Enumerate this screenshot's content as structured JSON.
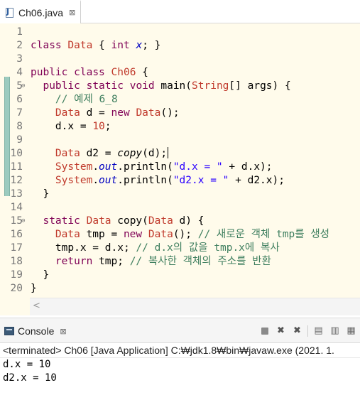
{
  "editor": {
    "tab_label": "Ch06.java",
    "lines": [
      {
        "n": "1"
      },
      {
        "n": "2"
      },
      {
        "n": "3"
      },
      {
        "n": "4"
      },
      {
        "n": "5",
        "fold": "⊖"
      },
      {
        "n": "6"
      },
      {
        "n": "7"
      },
      {
        "n": "8"
      },
      {
        "n": "9"
      },
      {
        "n": "10"
      },
      {
        "n": "11"
      },
      {
        "n": "12"
      },
      {
        "n": "13"
      },
      {
        "n": "14"
      },
      {
        "n": "15",
        "fold": "⊖"
      },
      {
        "n": "16"
      },
      {
        "n": "17"
      },
      {
        "n": "18"
      },
      {
        "n": "19"
      },
      {
        "n": "20"
      }
    ],
    "code": {
      "l2": [
        [
          "kw",
          "class"
        ],
        [
          "",
          " "
        ],
        [
          "cls",
          "Data"
        ],
        [
          "",
          " { "
        ],
        [
          "kw",
          "int"
        ],
        [
          "",
          " "
        ],
        [
          "fld",
          "x"
        ],
        [
          "",
          "; }"
        ]
      ],
      "l4": [
        [
          "kw",
          "public"
        ],
        [
          "",
          " "
        ],
        [
          "kw",
          "class"
        ],
        [
          "",
          " "
        ],
        [
          "cls",
          "Ch06"
        ],
        [
          "",
          " {"
        ]
      ],
      "l5": [
        [
          "",
          "  "
        ],
        [
          "kw",
          "public"
        ],
        [
          "",
          " "
        ],
        [
          "kw",
          "static"
        ],
        [
          "",
          " "
        ],
        [
          "kw",
          "void"
        ],
        [
          "",
          " main("
        ],
        [
          "cls",
          "String"
        ],
        [
          "",
          "[] args) {"
        ]
      ],
      "l6": [
        [
          "",
          "    "
        ],
        [
          "cm",
          "// 예제 6_8"
        ]
      ],
      "l7": [
        [
          "",
          "    "
        ],
        [
          "cls",
          "Data"
        ],
        [
          "",
          " d = "
        ],
        [
          "kw",
          "new"
        ],
        [
          "",
          " "
        ],
        [
          "cls",
          "Data"
        ],
        [
          "",
          "();"
        ]
      ],
      "l8": [
        [
          "",
          "    d.x = "
        ],
        [
          "num",
          "10"
        ],
        [
          "",
          ";"
        ]
      ],
      "l10": [
        [
          "",
          "    "
        ],
        [
          "cls",
          "Data"
        ],
        [
          "",
          " d2 = "
        ],
        [
          "it",
          "copy"
        ],
        [
          "",
          "(d);"
        ]
      ],
      "l11": [
        [
          "",
          "    "
        ],
        [
          "cls",
          "System"
        ],
        [
          "",
          "."
        ],
        [
          "fld",
          "out"
        ],
        [
          "",
          ".println("
        ],
        [
          "str",
          "\"d.x = \""
        ],
        [
          "",
          " + d.x);"
        ]
      ],
      "l12": [
        [
          "",
          "    "
        ],
        [
          "cls",
          "System"
        ],
        [
          "",
          "."
        ],
        [
          "fld",
          "out"
        ],
        [
          "",
          ".println("
        ],
        [
          "str",
          "\"d2.x = \""
        ],
        [
          "",
          " + d2.x);"
        ]
      ],
      "l13": [
        [
          "",
          "  }"
        ]
      ],
      "l15": [
        [
          "",
          "  "
        ],
        [
          "kw",
          "static"
        ],
        [
          "",
          " "
        ],
        [
          "cls",
          "Data"
        ],
        [
          "",
          " copy("
        ],
        [
          "cls",
          "Data"
        ],
        [
          "",
          " d) {"
        ]
      ],
      "l16": [
        [
          "",
          "    "
        ],
        [
          "cls",
          "Data"
        ],
        [
          "",
          " tmp = "
        ],
        [
          "kw",
          "new"
        ],
        [
          "",
          " "
        ],
        [
          "cls",
          "Data"
        ],
        [
          "",
          "(); "
        ],
        [
          "cm",
          "// 새로운 객체 tmp를 생성"
        ]
      ],
      "l17": [
        [
          "",
          "    tmp.x = d.x; "
        ],
        [
          "cm",
          "// d.x의 값을 tmp.x에 복사"
        ]
      ],
      "l18": [
        [
          "",
          "    "
        ],
        [
          "kw",
          "return"
        ],
        [
          "",
          " tmp; "
        ],
        [
          "cm",
          "// 복사한 객체의 주소를 반환"
        ]
      ],
      "l19": [
        [
          "",
          "  }"
        ]
      ],
      "l20": [
        [
          "",
          "}"
        ]
      ]
    }
  },
  "console": {
    "tab_label": "Console",
    "title": "<terminated> Ch06 [Java Application] C:₩jdk1.8₩bin₩javaw.exe (2021. 1.",
    "output": [
      "d.x = 10",
      "d2.x = 10"
    ]
  }
}
